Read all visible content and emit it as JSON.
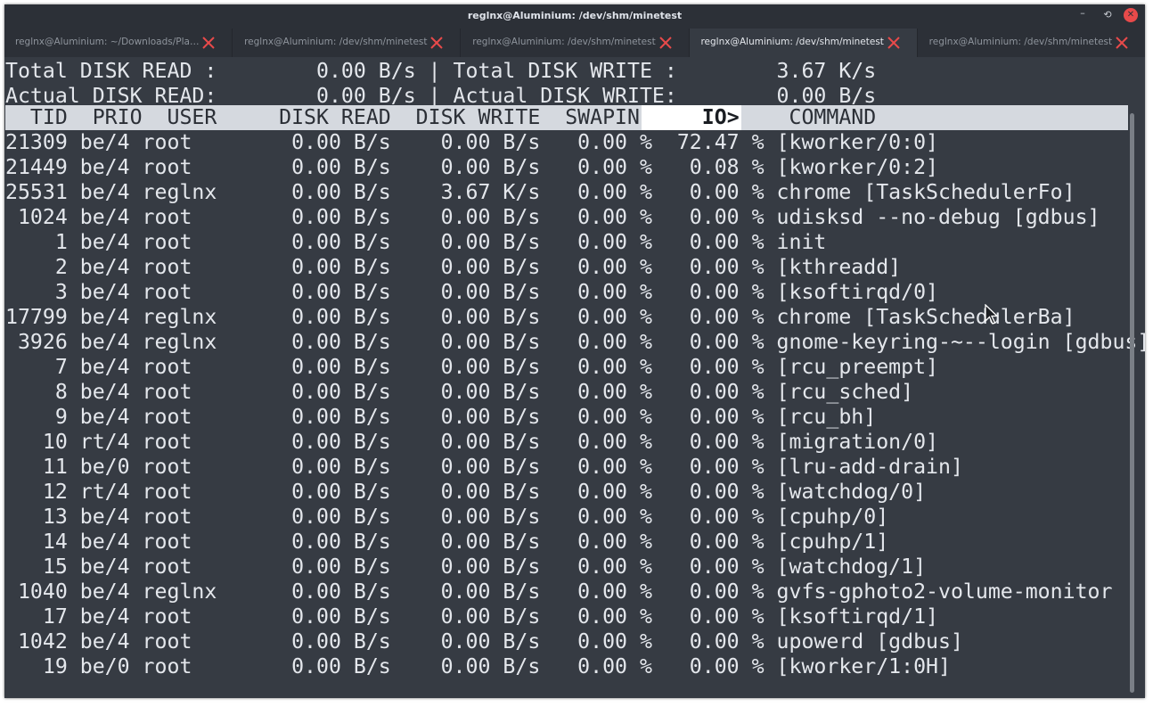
{
  "window": {
    "title": "reglnx@Aluminium: /dev/shm/minetest",
    "minimize_glyph": "–",
    "maximize_glyph": "⟲",
    "close_glyph": "✕"
  },
  "tabs": [
    {
      "label": "reglnx@Aluminium: ~/Downloads/Player...",
      "active": false
    },
    {
      "label": "reglnx@Aluminium: /dev/shm/minetest",
      "active": false
    },
    {
      "label": "reglnx@Aluminium: /dev/shm/minetest",
      "active": false
    },
    {
      "label": "reglnx@Aluminium: /dev/shm/minetest",
      "active": true
    },
    {
      "label": "reglnx@Aluminium: /dev/shm/minetest",
      "active": false
    }
  ],
  "colors": {
    "tab_close": "#e84a4a",
    "background": "#363b43",
    "header_bar": "#d5d9df"
  },
  "summary": {
    "line1": "Total DISK READ :        0.00 B/s | Total DISK WRITE :        3.67 K/s",
    "line2": "Actual DISK READ:        0.00 B/s | Actual DISK WRITE:        0.00 B/s"
  },
  "columns": {
    "pre_io": "  TID  PRIO  USER     DISK READ  DISK WRITE  SWAPIN",
    "io": "     IO>",
    "post_io": "    COMMAND"
  },
  "rows": [
    {
      "tid": "21309",
      "prio": "be/4",
      "user": "root",
      "read": "0.00 B/s",
      "write": "0.00 B/s",
      "swapin": "0.00 %",
      "io": "72.47 %",
      "command": "[kworker/0:0]"
    },
    {
      "tid": "21449",
      "prio": "be/4",
      "user": "root",
      "read": "0.00 B/s",
      "write": "0.00 B/s",
      "swapin": "0.00 %",
      "io": "0.08 %",
      "command": "[kworker/0:2]"
    },
    {
      "tid": "25531",
      "prio": "be/4",
      "user": "reglnx",
      "read": "0.00 B/s",
      "write": "3.67 K/s",
      "swapin": "0.00 %",
      "io": "0.00 %",
      "command": "chrome [TaskSchedulerFo]"
    },
    {
      "tid": "1024",
      "prio": "be/4",
      "user": "root",
      "read": "0.00 B/s",
      "write": "0.00 B/s",
      "swapin": "0.00 %",
      "io": "0.00 %",
      "command": "udisksd --no-debug [gdbus]"
    },
    {
      "tid": "1",
      "prio": "be/4",
      "user": "root",
      "read": "0.00 B/s",
      "write": "0.00 B/s",
      "swapin": "0.00 %",
      "io": "0.00 %",
      "command": "init"
    },
    {
      "tid": "2",
      "prio": "be/4",
      "user": "root",
      "read": "0.00 B/s",
      "write": "0.00 B/s",
      "swapin": "0.00 %",
      "io": "0.00 %",
      "command": "[kthreadd]"
    },
    {
      "tid": "3",
      "prio": "be/4",
      "user": "root",
      "read": "0.00 B/s",
      "write": "0.00 B/s",
      "swapin": "0.00 %",
      "io": "0.00 %",
      "command": "[ksoftirqd/0]"
    },
    {
      "tid": "17799",
      "prio": "be/4",
      "user": "reglnx",
      "read": "0.00 B/s",
      "write": "0.00 B/s",
      "swapin": "0.00 %",
      "io": "0.00 %",
      "command": "chrome [TaskSchedulerBa]"
    },
    {
      "tid": "3926",
      "prio": "be/4",
      "user": "reglnx",
      "read": "0.00 B/s",
      "write": "0.00 B/s",
      "swapin": "0.00 %",
      "io": "0.00 %",
      "command": "gnome-keyring-~--login [gdbus]"
    },
    {
      "tid": "7",
      "prio": "be/4",
      "user": "root",
      "read": "0.00 B/s",
      "write": "0.00 B/s",
      "swapin": "0.00 %",
      "io": "0.00 %",
      "command": "[rcu_preempt]"
    },
    {
      "tid": "8",
      "prio": "be/4",
      "user": "root",
      "read": "0.00 B/s",
      "write": "0.00 B/s",
      "swapin": "0.00 %",
      "io": "0.00 %",
      "command": "[rcu_sched]"
    },
    {
      "tid": "9",
      "prio": "be/4",
      "user": "root",
      "read": "0.00 B/s",
      "write": "0.00 B/s",
      "swapin": "0.00 %",
      "io": "0.00 %",
      "command": "[rcu_bh]"
    },
    {
      "tid": "10",
      "prio": "rt/4",
      "user": "root",
      "read": "0.00 B/s",
      "write": "0.00 B/s",
      "swapin": "0.00 %",
      "io": "0.00 %",
      "command": "[migration/0]"
    },
    {
      "tid": "11",
      "prio": "be/0",
      "user": "root",
      "read": "0.00 B/s",
      "write": "0.00 B/s",
      "swapin": "0.00 %",
      "io": "0.00 %",
      "command": "[lru-add-drain]"
    },
    {
      "tid": "12",
      "prio": "rt/4",
      "user": "root",
      "read": "0.00 B/s",
      "write": "0.00 B/s",
      "swapin": "0.00 %",
      "io": "0.00 %",
      "command": "[watchdog/0]"
    },
    {
      "tid": "13",
      "prio": "be/4",
      "user": "root",
      "read": "0.00 B/s",
      "write": "0.00 B/s",
      "swapin": "0.00 %",
      "io": "0.00 %",
      "command": "[cpuhp/0]"
    },
    {
      "tid": "14",
      "prio": "be/4",
      "user": "root",
      "read": "0.00 B/s",
      "write": "0.00 B/s",
      "swapin": "0.00 %",
      "io": "0.00 %",
      "command": "[cpuhp/1]"
    },
    {
      "tid": "15",
      "prio": "be/4",
      "user": "root",
      "read": "0.00 B/s",
      "write": "0.00 B/s",
      "swapin": "0.00 %",
      "io": "0.00 %",
      "command": "[watchdog/1]"
    },
    {
      "tid": "1040",
      "prio": "be/4",
      "user": "reglnx",
      "read": "0.00 B/s",
      "write": "0.00 B/s",
      "swapin": "0.00 %",
      "io": "0.00 %",
      "command": "gvfs-gphoto2-volume-monitor"
    },
    {
      "tid": "17",
      "prio": "be/4",
      "user": "root",
      "read": "0.00 B/s",
      "write": "0.00 B/s",
      "swapin": "0.00 %",
      "io": "0.00 %",
      "command": "[ksoftirqd/1]"
    },
    {
      "tid": "1042",
      "prio": "be/4",
      "user": "root",
      "read": "0.00 B/s",
      "write": "0.00 B/s",
      "swapin": "0.00 %",
      "io": "0.00 %",
      "command": "upowerd [gdbus]"
    },
    {
      "tid": "19",
      "prio": "be/0",
      "user": "root",
      "read": "0.00 B/s",
      "write": "0.00 B/s",
      "swapin": "0.00 %",
      "io": "0.00 %",
      "command": "[kworker/1:0H]"
    }
  ]
}
